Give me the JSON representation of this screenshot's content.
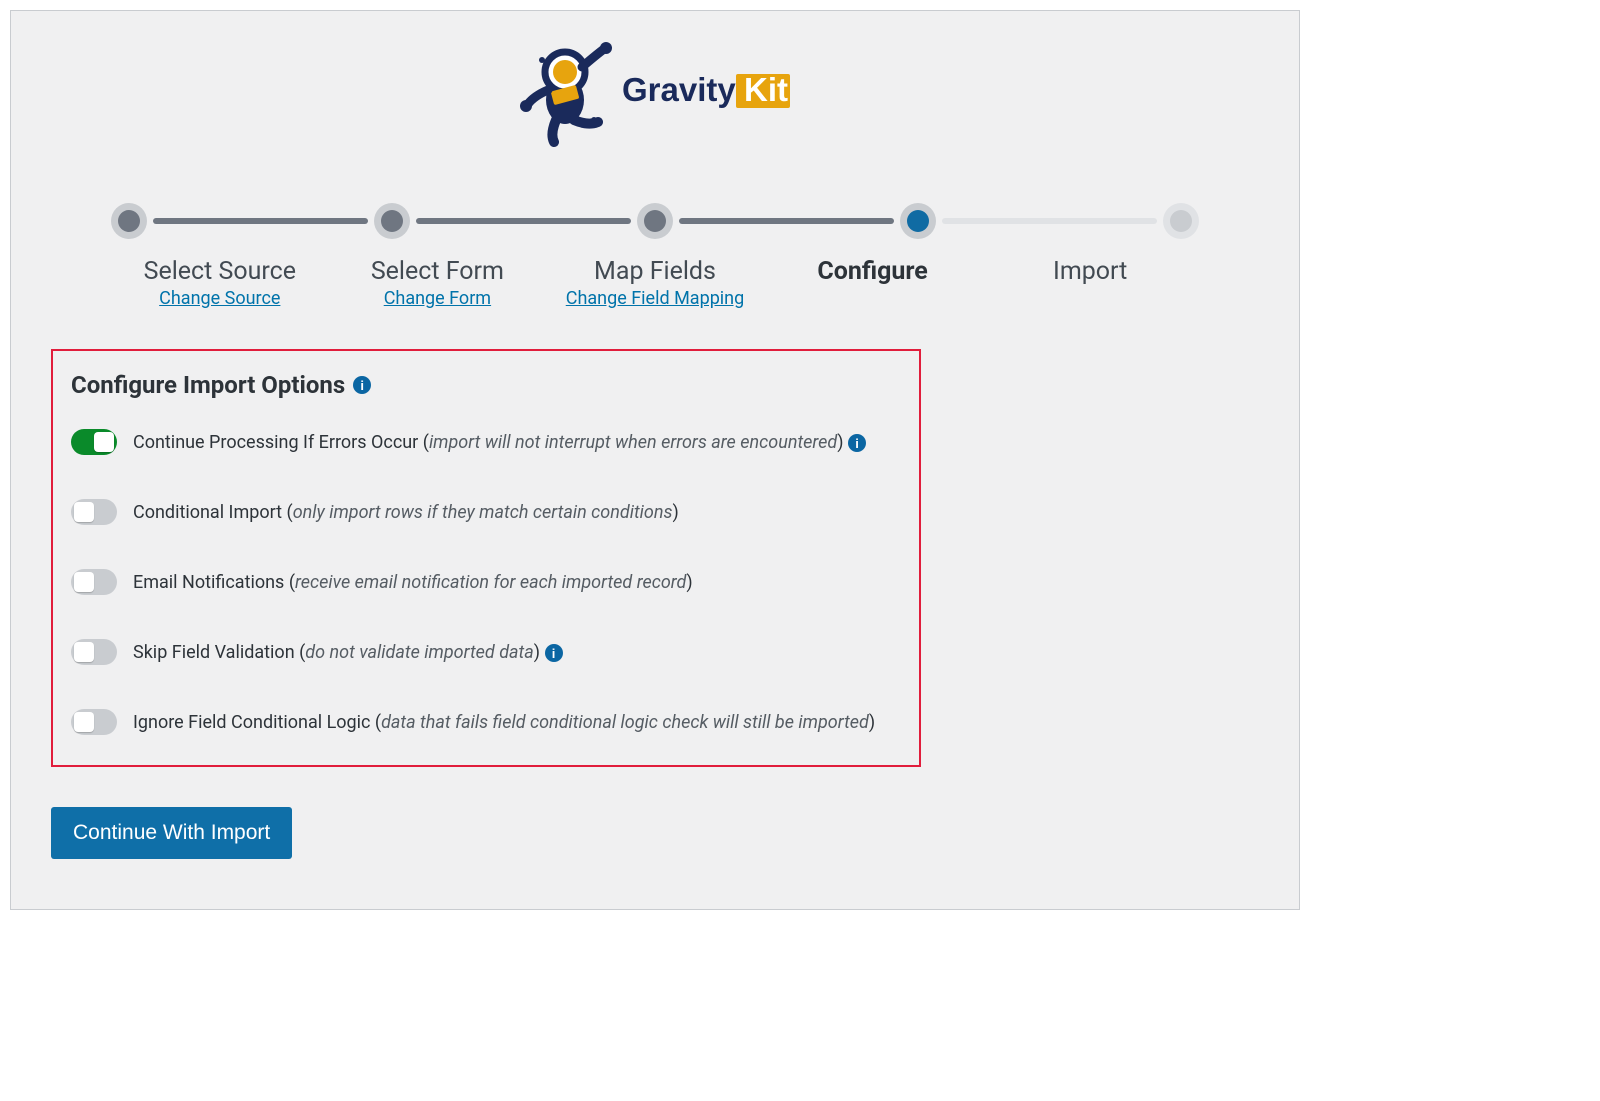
{
  "brand": {
    "name_a": "Gravity",
    "name_b": "Kit"
  },
  "steps": [
    {
      "label": "Select Source",
      "link": "Change Source",
      "state": "done"
    },
    {
      "label": "Select Form",
      "link": "Change Form",
      "state": "done"
    },
    {
      "label": "Map Fields",
      "link": "Change Field Mapping",
      "state": "done"
    },
    {
      "label": "Configure",
      "link": "",
      "state": "current"
    },
    {
      "label": "Import",
      "link": "",
      "state": "future"
    }
  ],
  "panel": {
    "heading": "Configure Import Options",
    "options": [
      {
        "title": "Continue Processing If Errors Occur",
        "hint": "import will not interrupt when errors are encountered",
        "on": true,
        "info": true
      },
      {
        "title": "Conditional Import",
        "hint": "only import rows if they match certain conditions",
        "on": false,
        "info": false
      },
      {
        "title": "Email Notifications",
        "hint": "receive email notification for each imported record",
        "on": false,
        "info": false
      },
      {
        "title": "Skip Field Validation",
        "hint": "do not validate imported data",
        "on": false,
        "info": true
      },
      {
        "title": "Ignore Field Conditional Logic",
        "hint": "data that fails field conditional logic check will still be imported",
        "on": false,
        "info": false
      }
    ]
  },
  "continue_label": "Continue With Import",
  "colors": {
    "accent": "#0f6fa8",
    "brand_yellow": "#e7a40e",
    "brand_navy": "#1a2a5b"
  }
}
